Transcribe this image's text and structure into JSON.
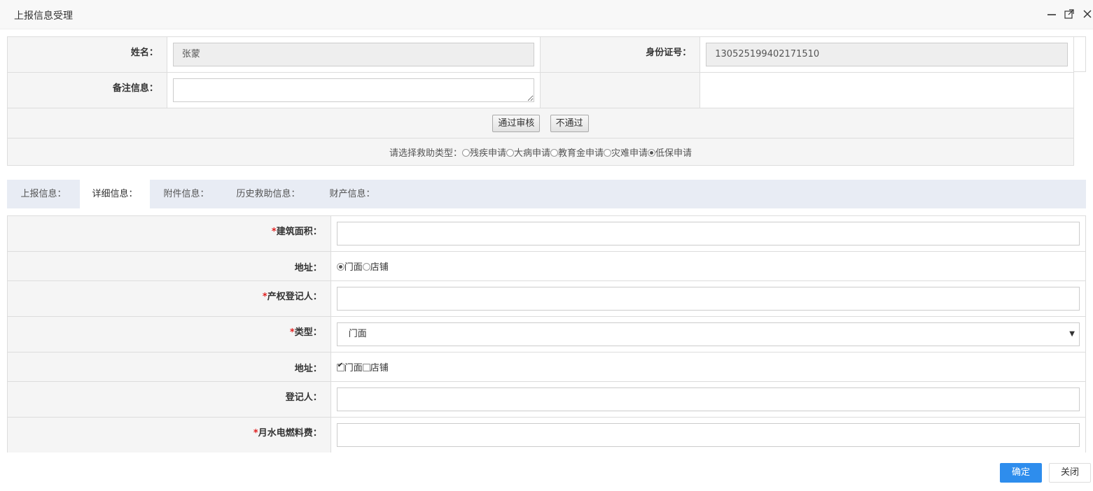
{
  "window": {
    "title": "上报信息受理"
  },
  "top_form": {
    "name_label": "姓名：",
    "name_value": "张蒙",
    "id_label": "身份证号：",
    "id_value": "130525199402171510",
    "remark_label": "备注信息：",
    "approve_button": "通过审核",
    "reject_button": "不通过",
    "aid_type_label": "请选择救助类型：",
    "aid_types": [
      {
        "label": "残疾申请",
        "checked": false
      },
      {
        "label": "大病申请",
        "checked": false
      },
      {
        "label": "教育金申请",
        "checked": false
      },
      {
        "label": "灾难申请",
        "checked": false
      },
      {
        "label": "低保申请",
        "checked": true
      }
    ]
  },
  "tabs": [
    {
      "label": "上报信息：",
      "active": false
    },
    {
      "label": "详细信息：",
      "active": true
    },
    {
      "label": "附件信息：",
      "active": false
    },
    {
      "label": "历史救助信息：",
      "active": false
    },
    {
      "label": "财产信息：",
      "active": false
    }
  ],
  "detail_form": {
    "area_label": "建筑面积：",
    "address_label": "地址：",
    "address_radio": [
      {
        "label": "门面",
        "checked": true
      },
      {
        "label": "店铺",
        "checked": false
      }
    ],
    "owner_label": "产权登记人：",
    "type_label": "类型：",
    "type_value": "门面",
    "address2_label": "地址：",
    "address_checkbox": [
      {
        "label": "门面",
        "checked": true
      },
      {
        "label": "店铺",
        "checked": false
      }
    ],
    "registrant_label": "登记人：",
    "utility_label": "月水电燃料费：",
    "required_mark": "*"
  },
  "footer": {
    "ok_button": "确定",
    "close_button": "关闭"
  }
}
